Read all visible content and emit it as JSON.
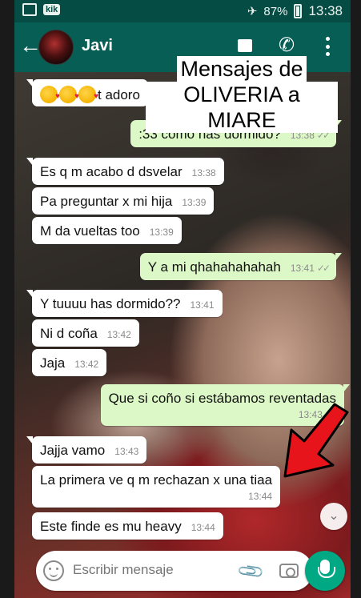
{
  "status_bar": {
    "app_badge": "kik",
    "battery": "87%",
    "time": "13:38"
  },
  "header": {
    "back_icon": "back-arrow-icon",
    "contact_name": "Javi"
  },
  "caption": {
    "line1": "Mensajes de",
    "line2": "OLIVERIA a MIARE"
  },
  "messages": [
    {
      "dir": "in",
      "text": "t adoro",
      "emoji_count": 3,
      "time": ""
    },
    {
      "dir": "out",
      "text": ":33 como has dormido?",
      "time": "13:38"
    },
    {
      "dir": "in",
      "text": "Es q m acabo d dsvelar",
      "time": "13:38"
    },
    {
      "dir": "in",
      "text": "Pa preguntar x mi hija",
      "time": "13:39"
    },
    {
      "dir": "in",
      "text": "M da vueltas too",
      "time": "13:39"
    },
    {
      "dir": "out",
      "text": "Y a mi qhahahahahah",
      "time": "13:41"
    },
    {
      "dir": "in",
      "text": "Y tuuuu has dormido??",
      "time": "13:41"
    },
    {
      "dir": "in",
      "text": "Ni d coña",
      "time": "13:42"
    },
    {
      "dir": "in",
      "text": "Jaja",
      "time": "13:42"
    },
    {
      "dir": "out",
      "text": "Que si coño si estábamos reventadas",
      "time": "13:43"
    },
    {
      "dir": "in",
      "text": "Jajja vamo",
      "time": "13:43"
    },
    {
      "dir": "in",
      "text": "La primera ve q m rechazan x una tiaa",
      "time": "13:44"
    },
    {
      "dir": "in",
      "text": "Este finde es mu heavy",
      "time": "13:44"
    }
  ],
  "input": {
    "placeholder": "Escribir mensaje"
  },
  "colors": {
    "header": "#075e54",
    "outgoing_bubble": "#dcf8c6",
    "incoming_bubble": "#ffffff",
    "fab": "#00a884"
  }
}
